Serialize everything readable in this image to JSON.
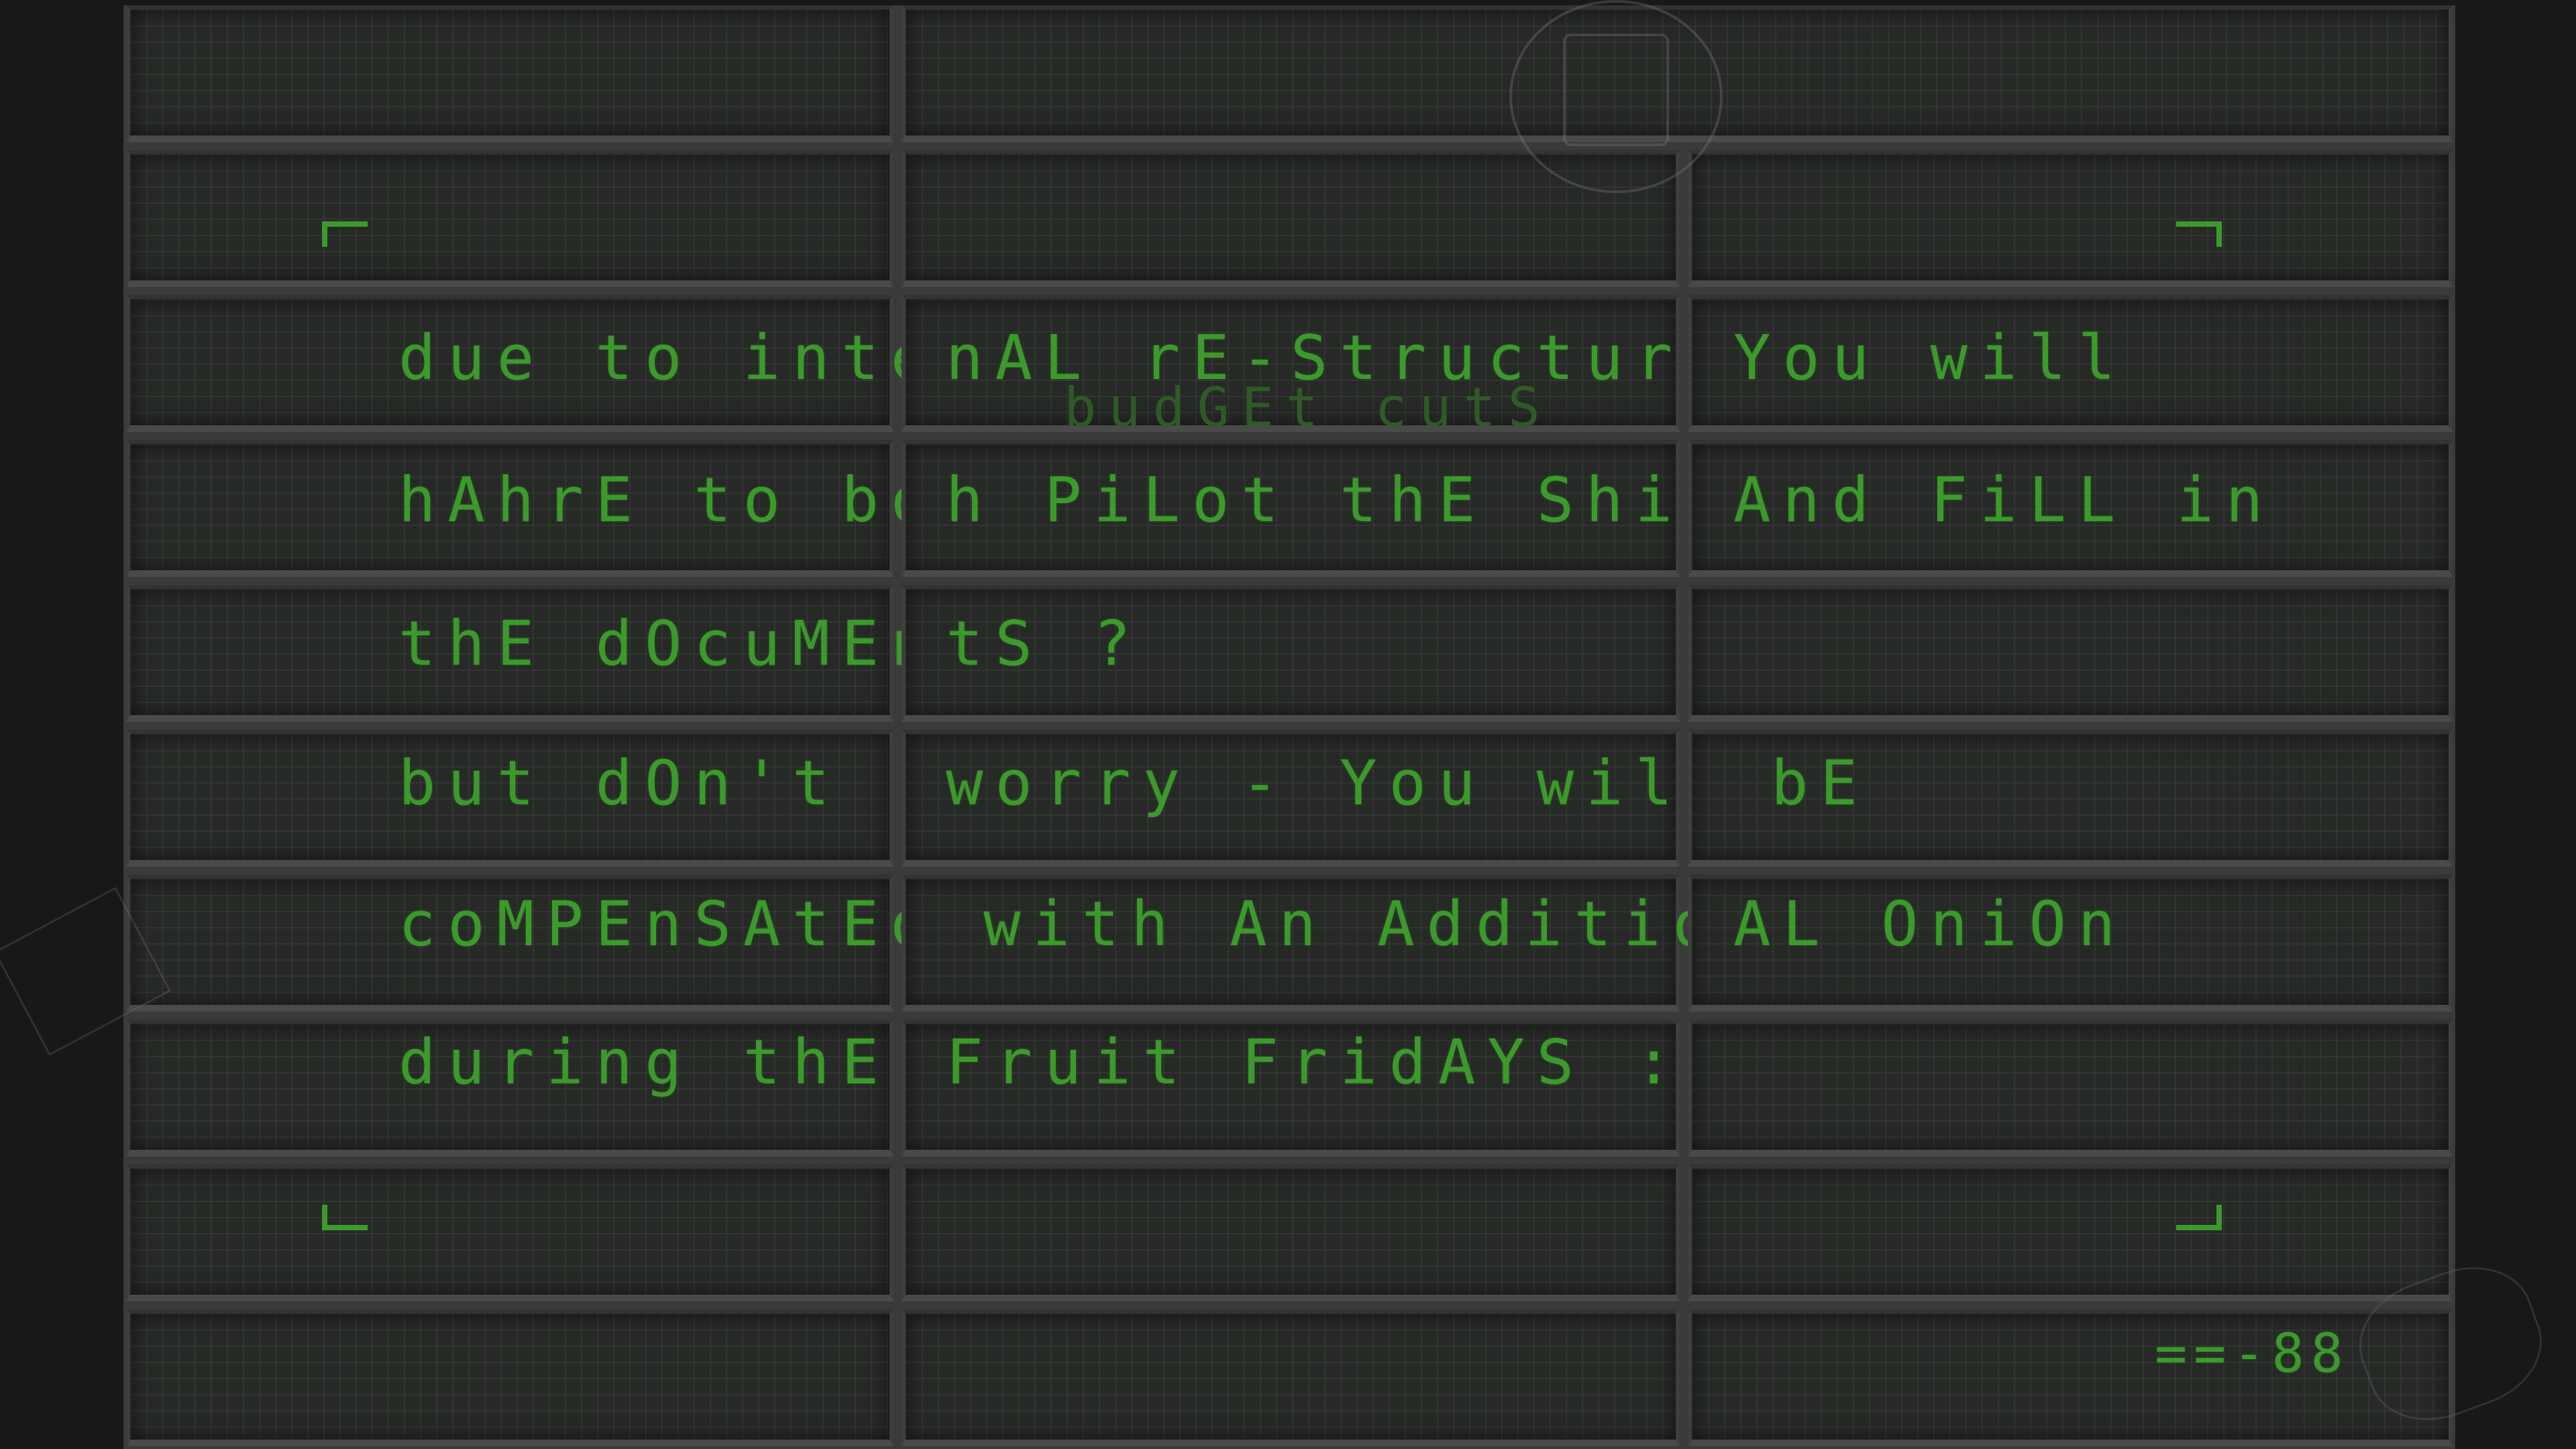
{
  "board": {
    "rows": [
      {
        "c0": "",
        "c1": "",
        "c2": ""
      },
      {
        "c0": "",
        "c1": "",
        "c2": ""
      },
      {
        "c0": "due to inter",
        "c1": "nAL rE-Structuring",
        "c2": "You will"
      },
      {
        "c0": "hAhrE to bot",
        "c1": "h PiLot thE ShiP",
        "c2": "And FiLL in"
      },
      {
        "c0": "thE dOcuMEn",
        "c1": "tS ?",
        "c2": ""
      },
      {
        "c0": "but dOn't",
        "c1": "worry - You will",
        "c2": "bE"
      },
      {
        "c0": "coMPEnSAtEd",
        "c1": "with An Addition",
        "c2": "AL OniOn"
      },
      {
        "c0": "during thE",
        "c1": "Fruit FridAYS :)",
        "c2": ""
      },
      {
        "c0": "",
        "c1": "",
        "c2": ""
      },
      {
        "c0": "",
        "c1": "",
        "c2": ""
      }
    ],
    "overlay_text": "budGEt cutS",
    "counter": "==-88"
  },
  "colors": {
    "lcd_green": "#3c9a2c",
    "lcd_faint": "#2f5a27",
    "panel": "#272927"
  }
}
